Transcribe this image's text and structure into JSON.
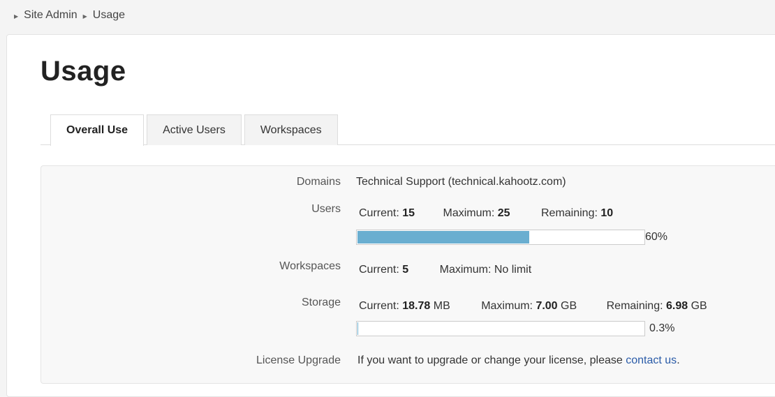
{
  "breadcrumb": [
    {
      "label": "Site Admin"
    },
    {
      "label": "Usage"
    }
  ],
  "page": {
    "title": "Usage"
  },
  "tabs": [
    {
      "label": "Overall Use",
      "active": true
    },
    {
      "label": "Active Users",
      "active": false
    },
    {
      "label": "Workspaces",
      "active": false
    }
  ],
  "details": {
    "domains": {
      "label": "Domains",
      "value": "Technical Support (technical.kahootz.com)"
    },
    "users": {
      "label": "Users",
      "current_label": "Current:",
      "current": "15",
      "maximum_label": "Maximum:",
      "maximum": "25",
      "remaining_label": "Remaining:",
      "remaining": "10",
      "percent_text": "60%",
      "fill_percent": 60
    },
    "workspaces": {
      "label": "Workspaces",
      "current_label": "Current:",
      "current": "5",
      "maximum_label": "Maximum:",
      "maximum": "No limit"
    },
    "storage": {
      "label": "Storage",
      "current_label": "Current:",
      "current": "18.78",
      "current_unit": "MB",
      "maximum_label": "Maximum:",
      "maximum": "7.00",
      "maximum_unit": "GB",
      "remaining_label": "Remaining:",
      "remaining": "6.98",
      "remaining_unit": "GB",
      "percent_text": "0.3%",
      "fill_percent": 0.3
    },
    "license": {
      "label": "License Upgrade",
      "text": "If you want to upgrade or change your license, please",
      "link_text": "contact us",
      "suffix": "."
    }
  },
  "colors": {
    "progress_fill": "#6aaed0",
    "link": "#2a5ba8"
  }
}
